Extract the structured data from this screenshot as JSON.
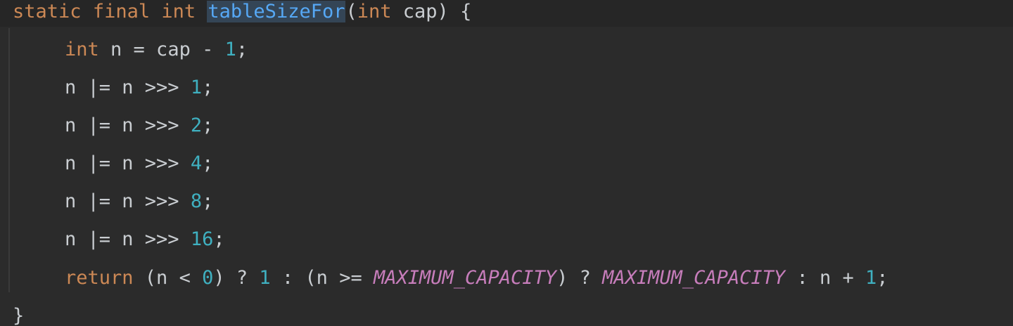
{
  "code": {
    "signature": {
      "modifier_static": "static",
      "modifier_final": "final",
      "return_type": "int",
      "method_name": "tableSizeFor",
      "open_paren": "(",
      "param_type": "int",
      "param_rest": " cap) {"
    },
    "line1": {
      "type": "int",
      "mid": " n = cap - ",
      "num": "1",
      "end": ";"
    },
    "line2": {
      "pre": "n |= n >>> ",
      "num": "1",
      "end": ";"
    },
    "line3": {
      "pre": "n |= n >>> ",
      "num": "2",
      "end": ";"
    },
    "line4": {
      "pre": "n |= n >>> ",
      "num": "4",
      "end": ";"
    },
    "line5": {
      "pre": "n |= n >>> ",
      "num": "8",
      "end": ";"
    },
    "line6": {
      "pre": "n |= n >>> ",
      "num": "16",
      "end": ";"
    },
    "return_line": {
      "kw": "return",
      "p1": " (n < ",
      "zero": "0",
      "p2": ") ? ",
      "one_a": "1",
      "p3": " : (n >= ",
      "const_a": "MAXIMUM_CAPACITY",
      "p4": ") ? ",
      "const_b": "MAXIMUM_CAPACITY",
      "p5": " : n + ",
      "one_b": "1",
      "end": ";"
    },
    "closing_brace": "}"
  },
  "colors": {
    "background": "#2b2b2b",
    "keyword": "#cc8855",
    "number": "#3fb0c0",
    "constant": "#c77dbb",
    "method_name": "#56a8f5",
    "method_highlight": "#344556",
    "text": "#c9cdd1"
  }
}
